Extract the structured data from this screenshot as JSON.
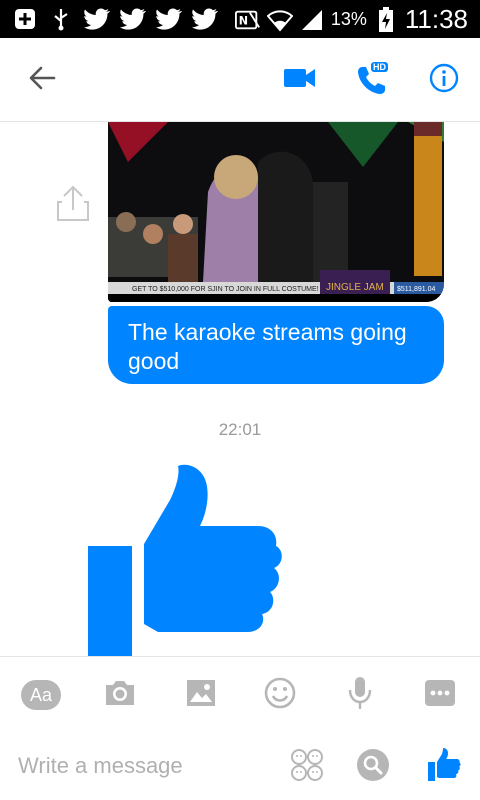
{
  "status_bar": {
    "battery_percent": "13%",
    "time": "11:38"
  },
  "header": {
    "back_icon": "arrow-left-icon",
    "video_icon": "video-camera-icon",
    "call_icon": "phone-hd-icon",
    "call_badge": "HD",
    "info_icon": "info-icon",
    "accent": "#0084ff"
  },
  "thread": {
    "image_caption_ticker": "GET TO $510,000 FOR SJIN TO JOIN IN FULL COSTUME!",
    "image_total": "$511,891.04",
    "image_event": "JINGLE JAM",
    "message_text": "The karaoke streams going good",
    "timestamp": "22:01",
    "like_icon": "thumbs-up-icon"
  },
  "composer": {
    "text_style_label": "Aa",
    "placeholder": "Write a message",
    "tools": [
      "text-style-icon",
      "camera-icon",
      "gallery-icon",
      "emoji-icon",
      "microphone-icon",
      "more-icon"
    ]
  }
}
